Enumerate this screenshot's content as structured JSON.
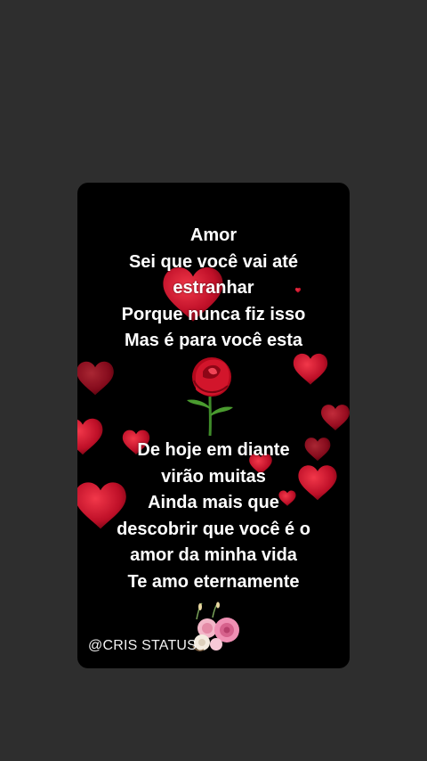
{
  "story": {
    "lines_top": [
      "Amor",
      "Sei que você vai até",
      "estranhar",
      "Porque nunca fiz isso",
      "Mas é para você esta"
    ],
    "lines_bottom": [
      "De hoje em diante",
      "virão muitas",
      "Ainda mais que",
      "descobrir que você é o",
      "amor da minha vida",
      "Te amo eternamente"
    ],
    "watermark": "@CRIS STATUS"
  },
  "colors": {
    "page_background": "#2e2e2e",
    "card_background": "#000000",
    "text": "#ffffff",
    "heart": "#d3122a"
  },
  "decorations": {
    "center_image": "red-rose-icon",
    "footer_image": "flower-bouquet-icon",
    "background": "floating-hearts"
  }
}
